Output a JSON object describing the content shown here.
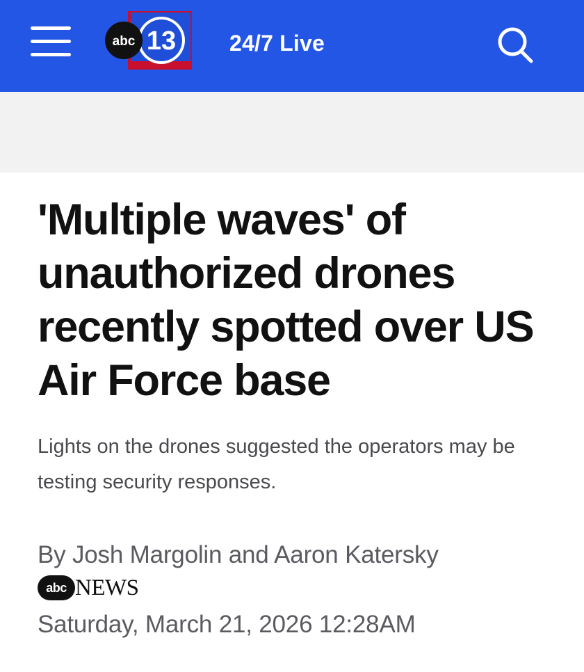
{
  "header": {
    "logo_text": "abc13",
    "live_label": "24/7 Live",
    "menu_icon": "hamburger-menu-icon",
    "search_icon": "search-icon",
    "background_color": "#2456e6"
  },
  "article": {
    "headline": "'Multiple waves' of unauthorized drones recently spotted over US Air Force base",
    "subheadline": "Lights on the drones suggested the operators may be testing security responses.",
    "byline": "By Josh Margolin and Aaron Katersky",
    "source": {
      "mark": "abc",
      "name": "NEWS"
    },
    "date": "Saturday, March 21, 2026 12:28AM"
  }
}
